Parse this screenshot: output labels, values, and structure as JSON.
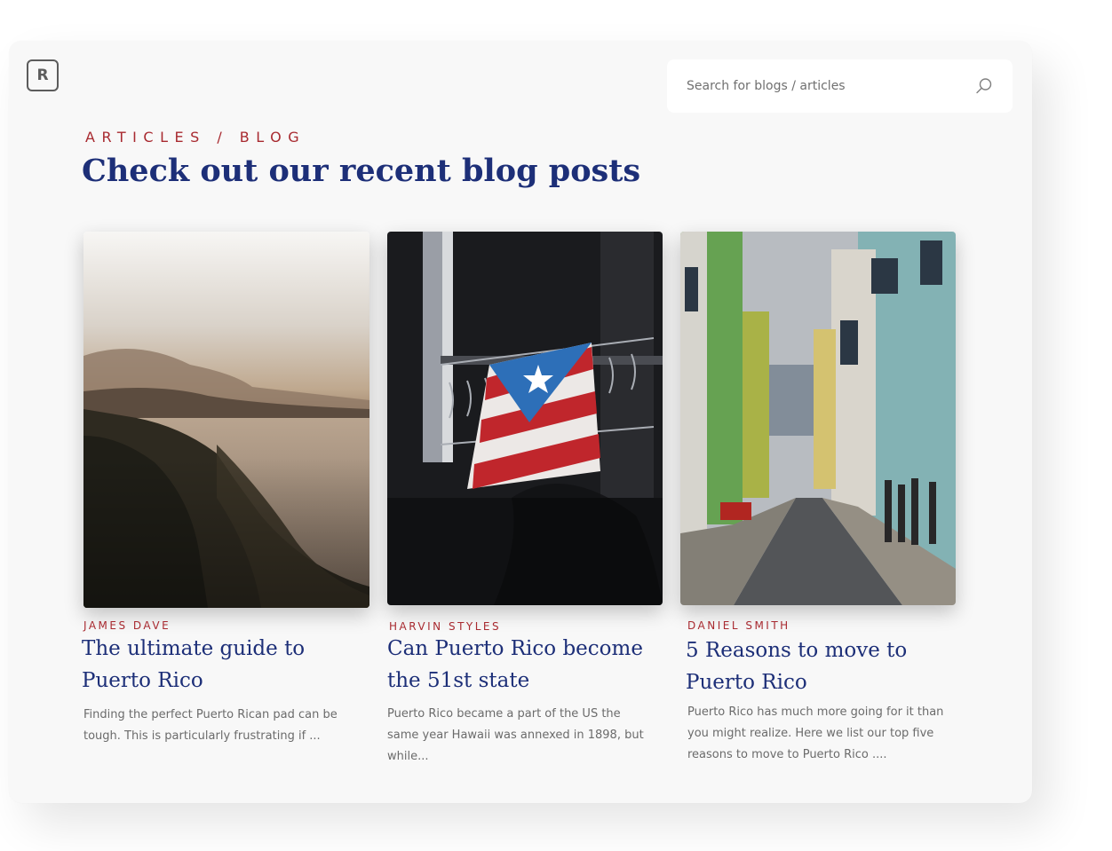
{
  "logo": {
    "letter": "R"
  },
  "search": {
    "placeholder": "Search for blogs / articles"
  },
  "header": {
    "eyebrow": "ARTICLES / BLOG",
    "title": "Check out our recent blog posts"
  },
  "posts": [
    {
      "author": "JAMES DAVE",
      "title": "The ultimate guide to Puerto Rico",
      "excerpt": "Finding the perfect Puerto Rican pad can be tough. This is particularly frustrating if ..."
    },
    {
      "author": "HARVIN STYLES",
      "title": "Can Puerto Rico become the 51st state",
      "excerpt": "Puerto Rico became a part of the US the same year Hawaii was annexed in 1898, but while..."
    },
    {
      "author": "DANIEL SMITH",
      "title": "5 Reasons to move to Puerto Rico",
      "excerpt": "Puerto Rico has much more going for it than you might realize. Here we list our top five reasons to move to Puerto Rico ...."
    }
  ],
  "colors": {
    "accent": "#a82a30",
    "heading": "#1d2f78",
    "text": "#6b6b6b",
    "panel": "#f8f8f8"
  }
}
